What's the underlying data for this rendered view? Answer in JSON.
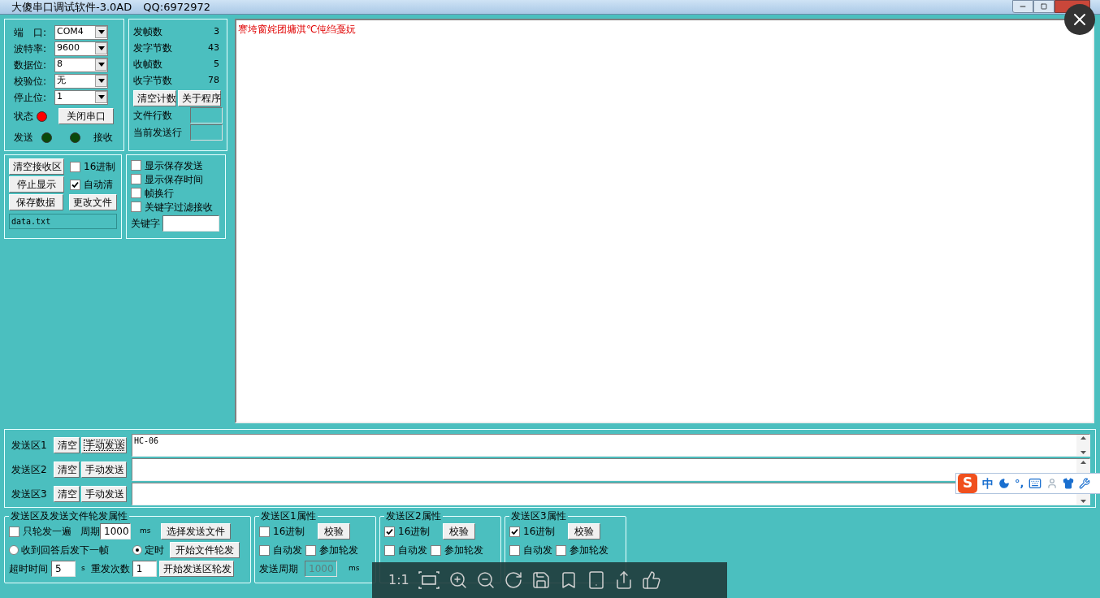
{
  "window": {
    "title": "大傻串口调试软件-3.0AD",
    "qq": "QQ:6972972"
  },
  "port": {
    "fields": [
      {
        "label": "端　口:",
        "value": "COM4"
      },
      {
        "label": "波特率:",
        "value": "9600"
      },
      {
        "label": "数据位:",
        "value": "8"
      },
      {
        "label": "校验位:",
        "value": "无"
      },
      {
        "label": "停止位:",
        "value": "1"
      }
    ],
    "status_label": "状态",
    "port_open": true,
    "toggle_button": "关闭串口",
    "send_label": "发送",
    "send_active": false,
    "receive_label": "接收",
    "receive_active": false
  },
  "counters": {
    "items": [
      {
        "label": "发帧数",
        "value": "3"
      },
      {
        "label": "发字节数",
        "value": "43"
      },
      {
        "label": "收帧数",
        "value": "5"
      },
      {
        "label": "收字节数",
        "value": "78"
      }
    ],
    "buttons": [
      "清空计数",
      "关于程序"
    ],
    "fields": [
      {
        "label": "文件行数"
      },
      {
        "label": "当前发送行"
      }
    ]
  },
  "receive_options": {
    "rows": [
      [
        {
          "kind": "button",
          "label": "清空接收区"
        },
        {
          "kind": "checkbox",
          "label": "16进制",
          "checked": false
        }
      ],
      [
        {
          "kind": "button",
          "label": "停止显示"
        },
        {
          "kind": "checkbox",
          "label": "自动清",
          "checked": true
        }
      ],
      [
        {
          "kind": "button",
          "label": "保存数据"
        },
        {
          "kind": "button",
          "label": "更改文件"
        }
      ]
    ],
    "file_name": "data.txt"
  },
  "display_options": {
    "checkboxes": [
      {
        "label": "显示保存发送",
        "checked": false
      },
      {
        "label": "显示保存时间",
        "checked": false
      },
      {
        "label": "帧换行",
        "checked": false
      },
      {
        "label": "关键字过滤接收",
        "checked": false
      }
    ],
    "keyword_label": "关键字"
  },
  "receive_text": "謇垮窗姹团墉淇℃伅绉戞妧",
  "send_zones": [
    {
      "label": "发送区1",
      "clear": "清空",
      "send": "手动发送",
      "focused": true,
      "value": "HC-06"
    },
    {
      "label": "发送区2",
      "clear": "清空",
      "send": "手动发送",
      "focused": false
    },
    {
      "label": "发送区3",
      "clear": "清空",
      "send": "手动发送",
      "focused": false
    }
  ],
  "rotation": {
    "title": "发送区及发送文件轮发属性",
    "once": {
      "label": "只轮发一遍",
      "checked": false
    },
    "period_label": "周期",
    "period": "1000",
    "period_unit": "ms",
    "modes": [
      {
        "label": "收到回答后发下一帧",
        "selected": false
      },
      {
        "label": "定时",
        "selected": true
      }
    ],
    "timeout_label": "超时时间",
    "timeout": "5",
    "timeout_unit": "s",
    "retry_label": "重发次数",
    "retry": "1",
    "buttons": [
      "选择发送文件",
      "开始文件轮发",
      "开始发送区轮发"
    ]
  },
  "zone_props": [
    {
      "title": "发送区1属性",
      "hex": {
        "label": "16进制",
        "checked": false
      },
      "check_button": "校验",
      "auto": {
        "label": "自动发",
        "checked": false
      },
      "rotate": {
        "label": "参加轮发",
        "checked": false
      },
      "period_label": "发送周期",
      "period": "1000",
      "unit": "ms"
    },
    {
      "title": "发送区2属性",
      "hex": {
        "label": "16进制",
        "checked": true
      },
      "check_button": "校验",
      "auto": {
        "label": "自动发",
        "checked": false
      },
      "rotate": {
        "label": "参加轮发",
        "checked": false
      }
    },
    {
      "title": "发送区3属性",
      "hex": {
        "label": "16进制",
        "checked": true
      },
      "check_button": "校验",
      "auto": {
        "label": "自动发",
        "checked": false
      },
      "rotate": {
        "label": "参加轮发",
        "checked": false
      }
    }
  ],
  "viewer_toolbar": {
    "zoom_label": "1:1"
  },
  "ime": {
    "logo": "S",
    "mode": "中",
    "punctuation": "°,"
  }
}
